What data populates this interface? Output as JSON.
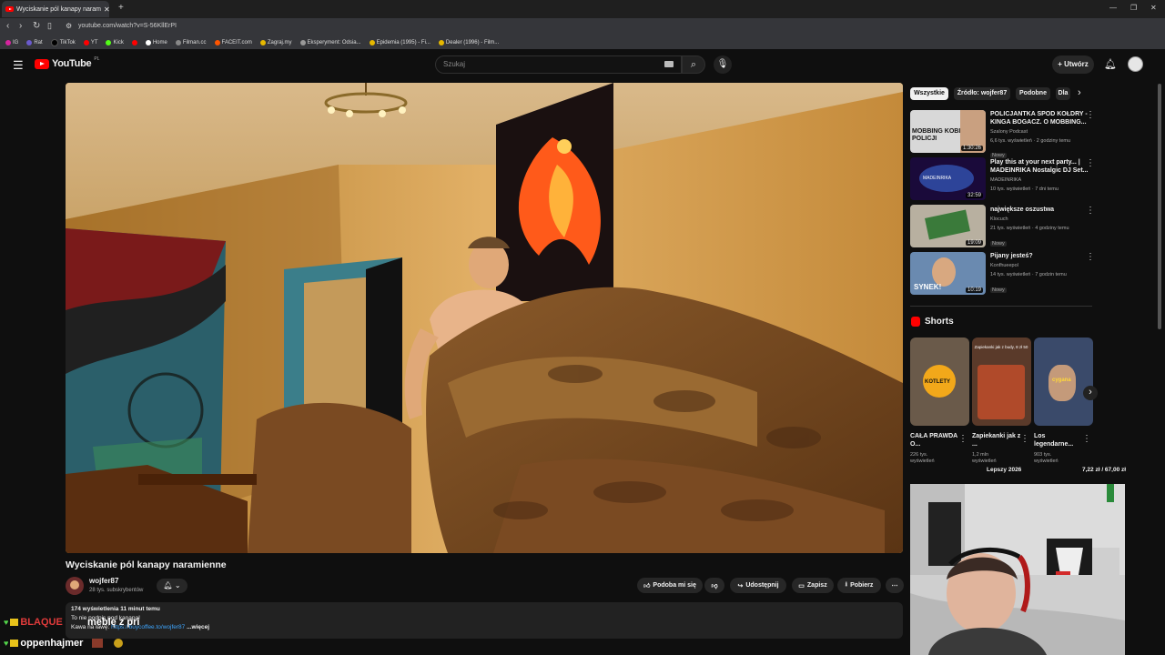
{
  "browser": {
    "tab_title": "Wyciskanie pól kanapy naram",
    "new_tab": "+",
    "url": "youtube.com/watch?v=S-56KllErPI",
    "bookmarks": [
      "IG",
      "Rat",
      "TikTok",
      "YT",
      "Kick",
      "Home",
      "Filman.cc",
      "FACEIT.com",
      "Zagraj.my",
      "Eksperyment: Odsia...",
      "Epidemia (1995) - Fi...",
      "Dealer (1996) - Film..."
    ]
  },
  "header": {
    "logo": "YouTube",
    "logo_region": "PL",
    "search_placeholder": "Szukaj",
    "create_label": "Utwórz"
  },
  "video": {
    "title": "Wyciskanie pól kanapy naramienne",
    "channel": "wojfer87",
    "subscribers": "28 tys. subskrybentów",
    "actions": {
      "like": "Podoba mi się",
      "share": "Udostępnij",
      "save": "Zapisz",
      "download": "Pobierz"
    },
    "description": {
      "stats": "174 wyświetlenia  11 minut temu",
      "line2": "To nie podpis pod kanapa!",
      "line3_prefix": "Kawa na ławę: ",
      "link": "https://buycoffee.to/wojfer87",
      "more": "...więcej"
    }
  },
  "sidebar": {
    "chips": [
      "Wszystkie",
      "Źródło: wojfer87",
      "Podobne",
      "Dla"
    ],
    "videos": [
      {
        "title": "POLICJANTKA SPOD KOŁDRY - KINGA BOGACZ. O MOBBING...",
        "channel": "Szalony Podcast",
        "views": "6,6 tys. wyświetleń · 2 godziny temu",
        "badge": "Nowy",
        "duration": "1:30:26",
        "thumb_text": "MOBBING KOBIET W POLICJI"
      },
      {
        "title": "Play this at your next party... | MADEINRIKA Nostalgic DJ Set...",
        "channel": "MADEINRIKA",
        "views": "10 tys. wyświetleń · 7 dni temu",
        "badge": "",
        "duration": "32:59",
        "thumb_text": "MADEINRIKA"
      },
      {
        "title": "największe oszustwa",
        "channel": "Klocuch",
        "views": "21 tys. wyświetleń · 4 godziny temu",
        "badge": "Nowy",
        "duration": "19:09",
        "thumb_text": ""
      },
      {
        "title": "Pijany jesteś?",
        "channel": "Konfhueepol",
        "views": "14 tys. wyświetleń · 7 godzin temu",
        "badge": "Nowy",
        "duration": "10:19",
        "thumb_text": "SYNEK!"
      }
    ],
    "shorts_heading": "Shorts",
    "shorts": [
      {
        "title": "CAŁA PRAWDA O...",
        "meta1": "226 tys.",
        "meta2": "wyświetleń",
        "thumb_text": "KOTLETY"
      },
      {
        "title": "Zapiekanki jak z ...",
        "meta1": "1,2 mln",
        "meta2": "wyświetleń",
        "thumb_text": "Zapiekanki jak z budy, 8 zł 50"
      },
      {
        "title": "Los legendarne...",
        "meta1": "903 tys.",
        "meta2": "wyświetleń",
        "thumb_text": "cygana"
      }
    ]
  },
  "stream": {
    "chat_user1": "BLAQUE",
    "chat_msg1": "meblę z pri",
    "chat_user2": "oppenhajmer",
    "overlay_left": "Lepszy 2026",
    "overlay_right": "7,22 zł / 67,00 zł"
  },
  "colors": {
    "youtube_red": "#ff0000",
    "background": "#0f0f0f",
    "chat_green": "#53d54b",
    "chat_red": "#e03b3b"
  }
}
